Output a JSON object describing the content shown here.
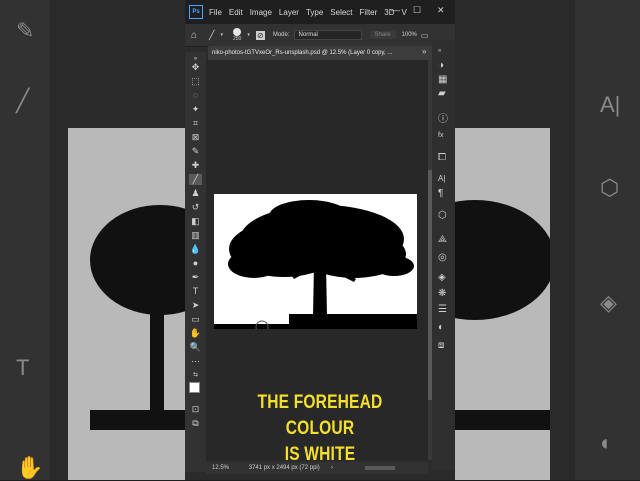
{
  "menubar": {
    "logo": "Ps",
    "items": [
      "File",
      "Edit",
      "Image",
      "Layer",
      "Type",
      "Select",
      "Filter",
      "3D",
      "V"
    ],
    "minimize": "—",
    "maximize": "☐",
    "close": "✕"
  },
  "options": {
    "brush_size": "250",
    "mode_label": "Mode:",
    "mode_value": "Normal",
    "share": "Share",
    "zoom": "100%"
  },
  "document": {
    "tab_title": "niko-photos-tGTVxeOr_Rs-unsplash.psd @ 12.5% (Layer 0 copy, ...",
    "more": "»"
  },
  "caption": {
    "line1": "THE FOREHEAD COLOUR",
    "line2": "IS WHITE"
  },
  "status": {
    "zoom": "12.5%",
    "dimensions": "3741 px x 2494 px (72 ppi)",
    "arrow": "›"
  },
  "colors": {
    "caption": "#f4e02a",
    "foreground": "#ffffff",
    "background": "#000000"
  }
}
